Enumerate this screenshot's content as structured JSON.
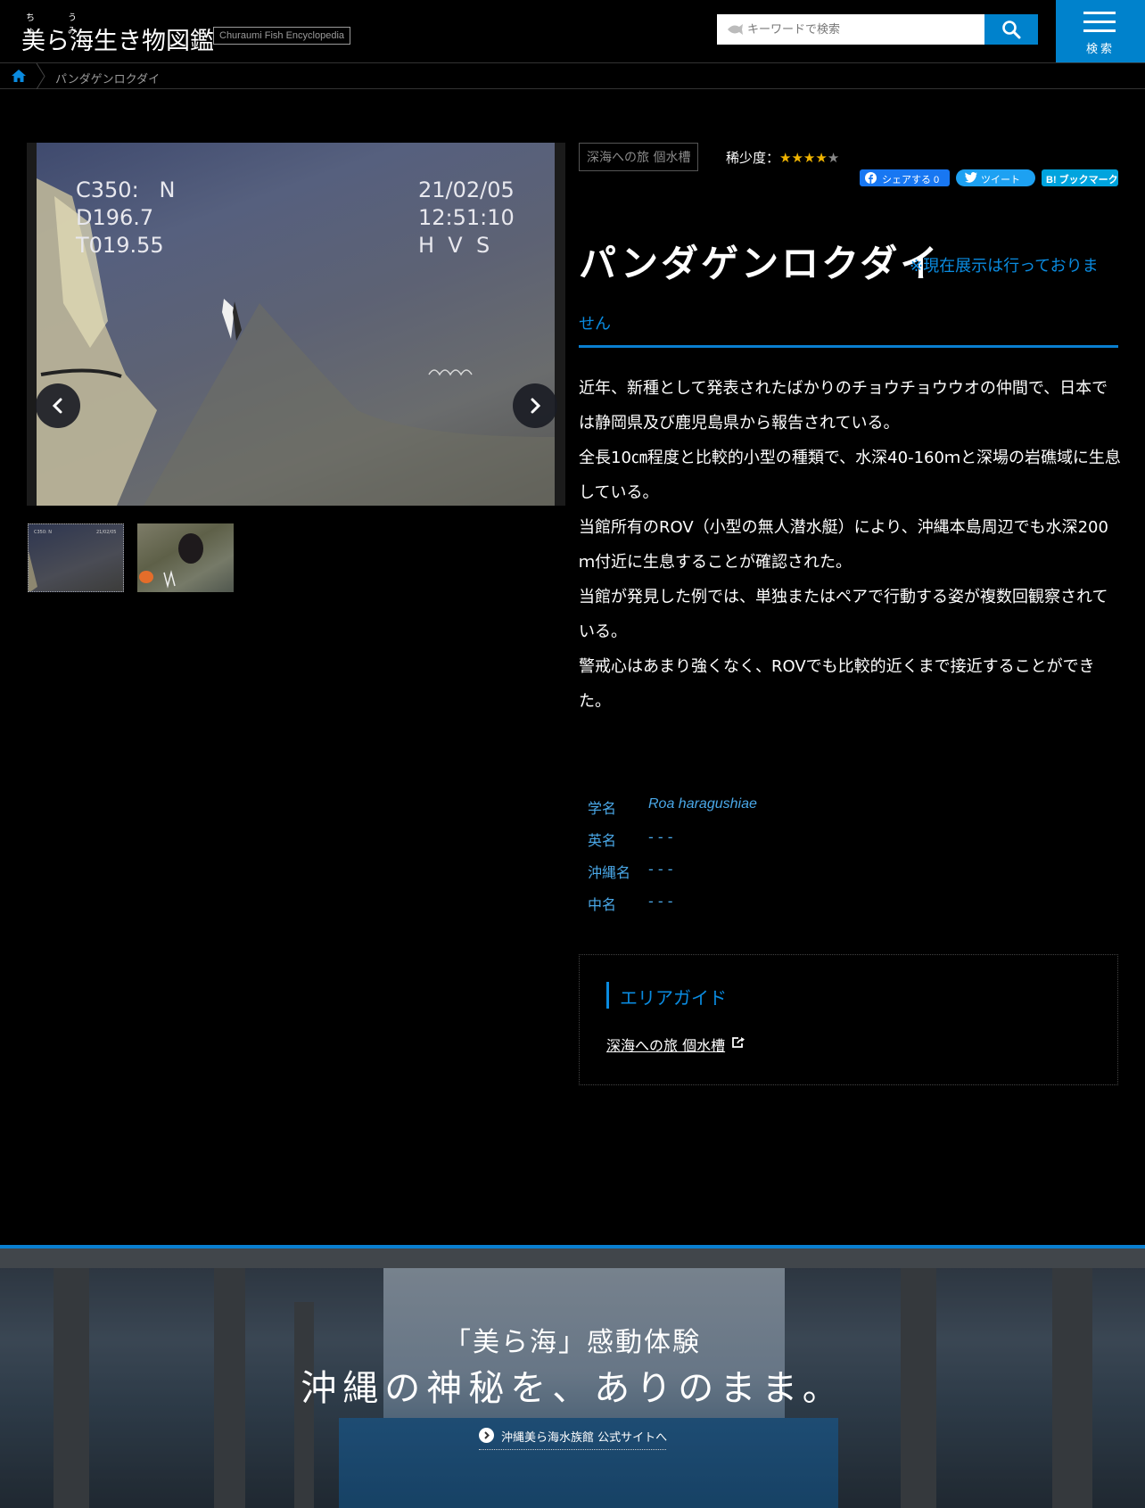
{
  "header": {
    "logo_title": "美ら海生き物図鑑",
    "logo_ruby_1": "ちゅ",
    "logo_ruby_2": "うみ",
    "logo_subtitle": "Churaumi Fish Encyclopedia",
    "search_placeholder": "キーワードで検索",
    "menu_label": "検索"
  },
  "breadcrumb": {
    "current": "パンダゲンロクダイ"
  },
  "gallery": {
    "overlay_left": "C350:   N\nD196.7\nT019.55",
    "overlay_right": "21/02/05\n12:51:10\nH  V  S",
    "thumbnails": [
      "photo-1",
      "photo-2"
    ]
  },
  "species": {
    "exhibit_tag": "深海への旅 個水槽",
    "rarity_label": "稀少度：",
    "rarity_stars_filled": "★★★★",
    "rarity_stars_empty": "★",
    "rarity_value": 4,
    "rarity_max": 5,
    "title": "パンダゲンロクダイ",
    "notice_part1": "※現在展示は行っておりま",
    "notice_part2": "せん",
    "description": [
      "近年、新種として発表されたばかりのチョウチョウウオの仲間で、日本では静岡県及び鹿児島県から報告されている。",
      "全長10㎝程度と比較的小型の種類で、水深40-160ｍと深場の岩礁域に生息している。",
      "当館所有のROV（小型の無人潜水艇）により、沖縄本島周辺でも水深200ｍ付近に生息することが確認された。",
      "当館が発見した例では、単独またはペアで行動する姿が複数回観察されている。",
      "警戒心はあまり強くなく、ROVでも比較的近くまで接近することができた。"
    ],
    "info": {
      "scientific_label": "学名",
      "scientific_value": "Roa haragushiae",
      "english_label": "英名",
      "english_value": "- - -",
      "okinawa_label": "沖縄名",
      "okinawa_value": "- - -",
      "chinese_label": "中名",
      "chinese_value": "- - -"
    }
  },
  "share": {
    "facebook_label": "シェアする 0",
    "twitter_label": "ツイート",
    "hatena_label": "B! ブックマーク"
  },
  "area_guide": {
    "heading": "エリアガイド",
    "link_text": "深海への旅 個水槽"
  },
  "banner": {
    "subtitle": "「美ら海」感動体験",
    "main": "沖縄の神秘を、ありのまま。",
    "link_text": "沖縄美ら海水族館 公式サイトへ"
  },
  "colors": {
    "accent": "#0082cc",
    "link_blue": "#0a8be0",
    "info_blue": "#4aa8e8",
    "star": "#f0b400"
  }
}
